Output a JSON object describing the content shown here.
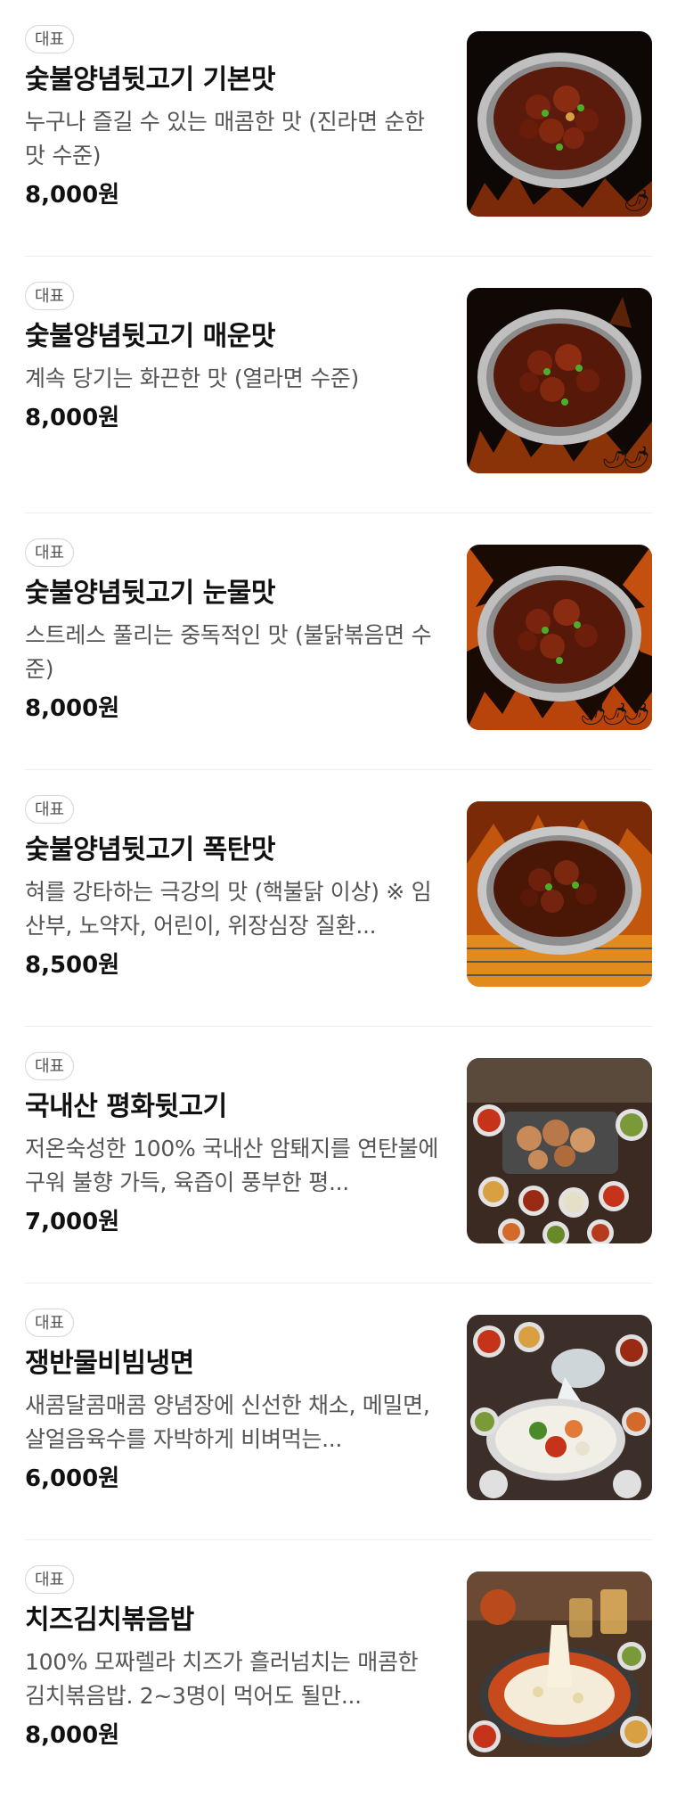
{
  "badge_label": "대표",
  "items": [
    {
      "name": "숯불양념뒷고기 기본맛",
      "desc": "누구나 즐길 수 있는 매콤한 맛 (진라면 순한맛 수준)",
      "price": "8,000원",
      "image": "fire-plate",
      "chili_count": 1
    },
    {
      "name": "숯불양념뒷고기 매운맛",
      "desc": "계속 당기는 화끈한 맛 (열라면 수준)",
      "price": "8,000원",
      "image": "fire-plate",
      "chili_count": 2
    },
    {
      "name": "숯불양념뒷고기 눈물맛",
      "desc": "스트레스 풀리는 중독적인 맛 (불닭볶음면 수준)",
      "price": "8,000원",
      "image": "fire-plate",
      "chili_count": 3
    },
    {
      "name": "숯불양념뒷고기 폭탄맛",
      "desc": "혀를 강타하는 극강의 맛 (핵불닭 이상) ※ 임산부, 노약자, 어린이, 위장심장 질환...",
      "price": "8,500원",
      "image": "fire-plate-flames",
      "chili_count": 0
    },
    {
      "name": "국내산 평화뒷고기",
      "desc": "저온숙성한 100% 국내산 암퇘지를 연탄불에 구워 불향 가득, 육즙이 풍부한 평...",
      "price": "7,000원",
      "image": "table-spread",
      "chili_count": 0
    },
    {
      "name": "쟁반물비빔냉면",
      "desc": "새콤달콤매콤 양념장에 신선한 채소, 메밀면, 살얼음육수를 자박하게 비벼먹는...",
      "price": "6,000원",
      "image": "noodle-table",
      "chili_count": 0
    },
    {
      "name": "치즈김치볶음밥",
      "desc": "100% 모짜렐라 치즈가 흘러넘치는 매콤한 김치볶음밥. 2~3명이 먹어도 될만...",
      "price": "8,000원",
      "image": "cheese-rice",
      "chili_count": 0
    }
  ],
  "colors": {
    "badge_border": "#d6d6d6",
    "text_primary": "#111111",
    "text_secondary": "#555555",
    "divider": "#ececec"
  }
}
